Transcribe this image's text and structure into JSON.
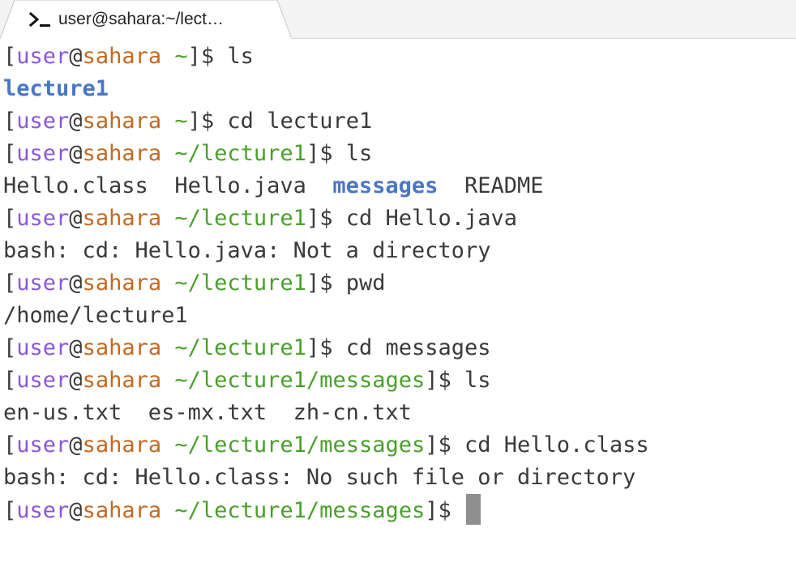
{
  "tab": {
    "title": "user@sahara:~/lect…",
    "icon": "terminal-prompt-icon"
  },
  "colors": {
    "user": "#8a58d6",
    "host": "#c46a20",
    "path": "#4aa02c",
    "directory": "#4a77c4",
    "text": "#3a3a3a",
    "cursor": "#8f8f8f"
  },
  "prompt": {
    "open": "[",
    "user": "user",
    "at": "@",
    "host": "sahara",
    "close": "]$ "
  },
  "lines": [
    {
      "type": "prompt",
      "path": "~",
      "command": "ls"
    },
    {
      "type": "output",
      "parts": [
        {
          "text": "lecture1",
          "kind": "dir"
        }
      ]
    },
    {
      "type": "prompt",
      "path": "~",
      "command": "cd lecture1"
    },
    {
      "type": "prompt",
      "path": "~/lecture1",
      "command": "ls"
    },
    {
      "type": "output",
      "parts": [
        {
          "text": "Hello.class  Hello.java  ",
          "kind": "plain"
        },
        {
          "text": "messages",
          "kind": "dir"
        },
        {
          "text": "  README",
          "kind": "plain"
        }
      ]
    },
    {
      "type": "prompt",
      "path": "~/lecture1",
      "command": "cd Hello.java"
    },
    {
      "type": "output",
      "parts": [
        {
          "text": "bash: cd: Hello.java: Not a directory",
          "kind": "plain"
        }
      ]
    },
    {
      "type": "prompt",
      "path": "~/lecture1",
      "command": "pwd"
    },
    {
      "type": "output",
      "parts": [
        {
          "text": "/home/lecture1",
          "kind": "plain"
        }
      ]
    },
    {
      "type": "prompt",
      "path": "~/lecture1",
      "command": "cd messages"
    },
    {
      "type": "prompt",
      "path": "~/lecture1/messages",
      "command": "ls"
    },
    {
      "type": "output",
      "parts": [
        {
          "text": "en-us.txt  es-mx.txt  zh-cn.txt",
          "kind": "plain"
        }
      ]
    },
    {
      "type": "prompt",
      "path": "~/lecture1/messages",
      "command": "cd Hello.class"
    },
    {
      "type": "output",
      "parts": [
        {
          "text": "bash: cd: Hello.class: No such file or directory",
          "kind": "plain"
        }
      ]
    },
    {
      "type": "prompt",
      "path": "~/lecture1/messages",
      "command": "",
      "cursor": true
    }
  ]
}
